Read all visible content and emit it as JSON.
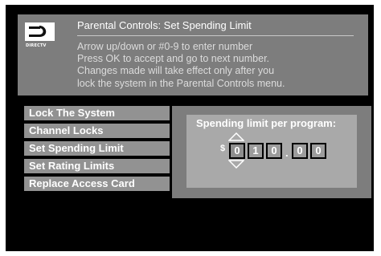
{
  "header": {
    "title": "Parental Controls: Set Spending Limit",
    "logo_text": "DIRECTV",
    "instructions": [
      "Arrow up/down or #0-9 to enter number",
      "Press OK to accept and go to next number.",
      "Changes made will take effect only after you",
      "lock the system in the Parental Controls menu."
    ]
  },
  "menu": {
    "items": [
      "Lock The System",
      "Channel Locks",
      "Set Spending Limit",
      "Set Rating Limits",
      "Replace Access Card"
    ]
  },
  "spending_panel": {
    "label": "Spending limit per program:",
    "currency": "$",
    "decimal": ".",
    "digits": [
      "0",
      "1",
      "0",
      "0",
      "0"
    ]
  },
  "colors": {
    "screen": "#000000",
    "panel": "#7d7d7d",
    "menu_item": "#929292",
    "text": "#ffffff",
    "instruction_text": "#dcdcdc"
  },
  "icons": {
    "logo": "directv-logo-icon",
    "up": "arrow-up-icon",
    "down": "arrow-down-icon"
  }
}
